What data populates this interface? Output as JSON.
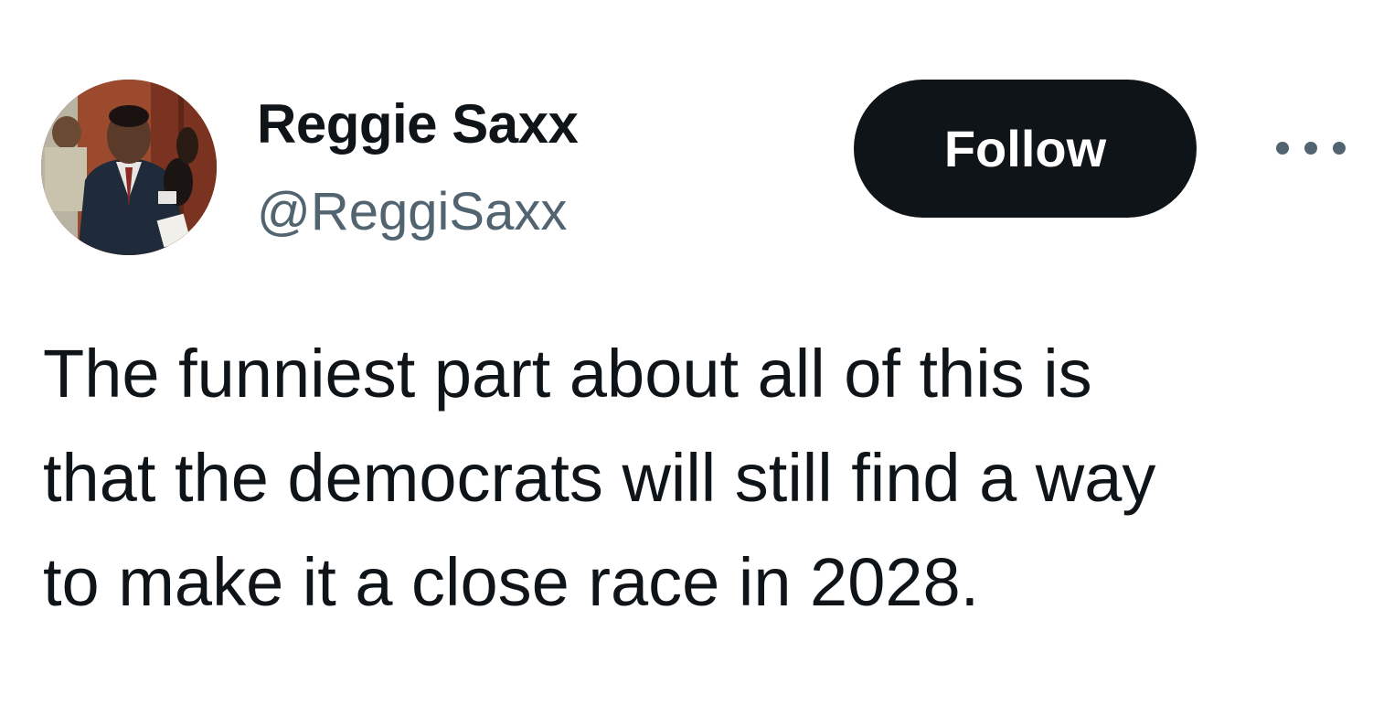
{
  "author": {
    "display_name": "Reggie Saxx",
    "handle": "@ReggiSaxx",
    "avatar_icon": "profile-photo"
  },
  "actions": {
    "follow_label": "Follow",
    "more_icon": "more-horizontal-icon"
  },
  "tweet": {
    "lines": [
      "The funniest part about all of this is",
      "that the democrats will still find a way",
      "to make it a close race in 2028."
    ]
  },
  "colors": {
    "text_primary": "#0f1419",
    "text_secondary": "#536471",
    "button_bg": "#0f1419",
    "button_text": "#ffffff",
    "background": "#ffffff"
  }
}
